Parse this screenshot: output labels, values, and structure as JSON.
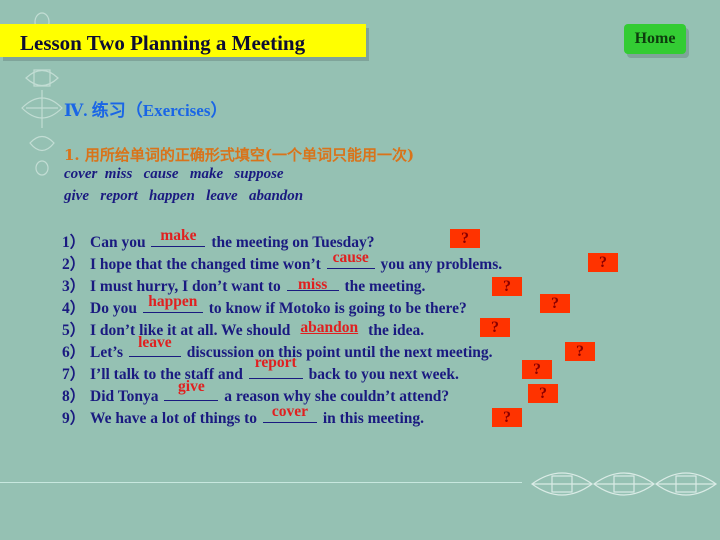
{
  "header": {
    "title": "Lesson Two  Planning a Meeting",
    "home_label": "Home"
  },
  "colors": {
    "background": "#95c1b3",
    "title_bar": "#ffff00",
    "home_button": "#33cc33",
    "heading": "#1a66e6",
    "instruction": "#d9731a",
    "text": "#1a1a80",
    "answer": "#e02020",
    "hint_box": "#ff3300"
  },
  "section": {
    "heading": "Ⅳ. 练习（Exercises）",
    "instruction": "1. 用所给单词的正确形式填空(一个单词只能用一次)",
    "word_bank_line1": "cover  miss   cause   make   suppose",
    "word_bank_line2": "give   report   happen   leave   abandon"
  },
  "sentences": [
    {
      "num": "1）",
      "before": "Can you ",
      "answer": "make",
      "after": " the meeting on Tuesday?",
      "hint": "?"
    },
    {
      "num": "2）",
      "before": "I hope that the changed time won’t ",
      "answer": "cause",
      "after": " you any problems.",
      "hint": "?"
    },
    {
      "num": "3）",
      "before": "I must hurry, I don’t want to ",
      "answer": "miss",
      "after": " the meeting.",
      "hint": "?"
    },
    {
      "num": "4）",
      "before": "Do you ",
      "answer": "happen",
      "after": " to know if Motoko is going to be there?",
      "hint": "?"
    },
    {
      "num": "5）",
      "before": "I don’t like it at all. We should ",
      "answer": "abandon",
      "after": " the idea.",
      "hint": "?"
    },
    {
      "num": "6）",
      "before": "Let’s ",
      "answer": "leave",
      "after": " discussion on this point until the next meeting.",
      "hint": "?"
    },
    {
      "num": "7）",
      "before": "I’ll talk to the staff and ",
      "answer": "report",
      "after": " back to you next week.",
      "hint": "?"
    },
    {
      "num": "8）",
      "before": "Did Tonya ",
      "answer": "give",
      "after": " a reason why she couldn’t attend?",
      "hint": "?"
    },
    {
      "num": "9）",
      "before": "We have a lot of things to ",
      "answer": "cover",
      "after": " in this meeting.",
      "hint": "?"
    }
  ]
}
